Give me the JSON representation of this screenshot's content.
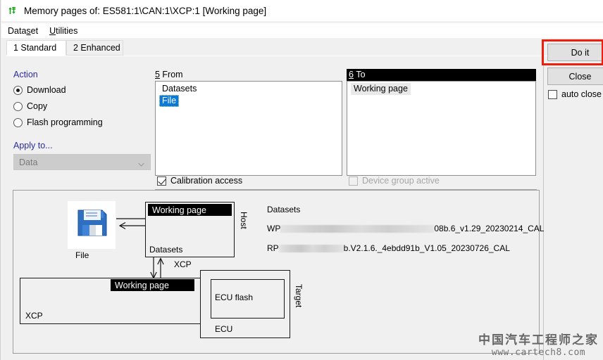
{
  "window": {
    "title": "Memory pages of: ES581:1\\CAN:1\\XCP:1 [Working page]",
    "icon": "memory-pages-icon"
  },
  "menu": {
    "items": [
      {
        "label": "Dataset",
        "accel_index": 5
      },
      {
        "label": "Utilities",
        "accel_index": 0
      }
    ]
  },
  "tabs": [
    {
      "label": "1 Standard",
      "active": true
    },
    {
      "label": "2 Enhanced",
      "active": false
    }
  ],
  "action": {
    "group_label": "Action",
    "options": [
      {
        "label": "Download",
        "checked": true
      },
      {
        "label": "Copy",
        "checked": false
      },
      {
        "label": "Flash programming",
        "checked": false
      }
    ],
    "apply_to_label": "Apply to...",
    "apply_to_value": "Data",
    "apply_to_enabled": false
  },
  "from": {
    "label": "5 From",
    "items": [
      {
        "text": "Datasets",
        "state": "normal"
      },
      {
        "text": "File",
        "state": "selected"
      }
    ]
  },
  "to": {
    "label": "6 To",
    "focused": true,
    "items": [
      {
        "text": "Working page",
        "state": "soft-selected"
      }
    ]
  },
  "checkboxes": {
    "calibration_access": {
      "label": "Calibration access",
      "checked": true,
      "enabled": true
    },
    "device_group_active": {
      "label": "Device group active",
      "checked": false,
      "enabled": false
    },
    "auto_close": {
      "label": "auto close",
      "checked": false,
      "enabled": true
    }
  },
  "buttons": {
    "do_it": "Do it",
    "close": "Close"
  },
  "annotation": {
    "highlight_color": "#f01c0c",
    "target": "do-it-button"
  },
  "diagram": {
    "file_label": "File",
    "host_label": "Host",
    "target_label": "Target",
    "host_working_page": "Working page",
    "host_datasets": "Datasets",
    "xcp_link_label": "XCP",
    "target_xcp_label": "XCP",
    "target_working_page": "Working page",
    "ecu_flash_label": "ECU flash",
    "ecu_label": "ECU",
    "datasets_title": "Datasets",
    "datasets": [
      {
        "prefix": "WP",
        "redacted": true,
        "suffix": "08b.6_v1.29_20230214_CAL"
      },
      {
        "prefix": "RP",
        "redacted": true,
        "suffix": "b.V2.1.6._4ebdd91b_V1.05_20230726_CAL"
      }
    ]
  },
  "watermark": {
    "cn": "中国汽车工程师之家",
    "url": "www.cartech8.com"
  }
}
